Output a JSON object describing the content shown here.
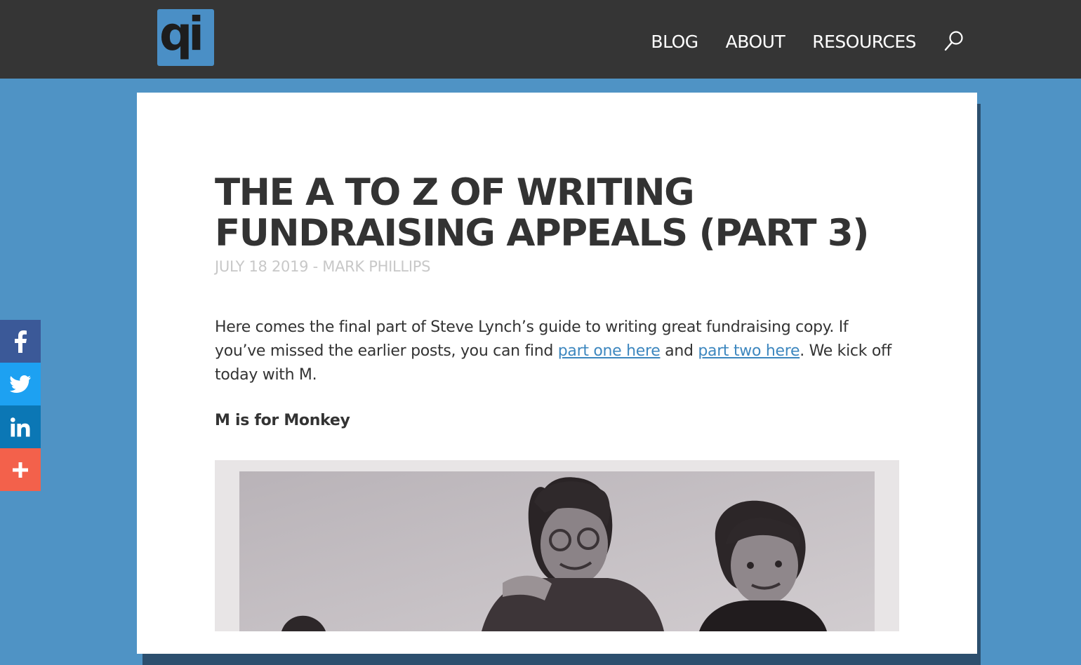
{
  "header": {
    "logo_text": "qi",
    "nav": {
      "blog": "BLOG",
      "about": "ABOUT",
      "resources": "RESOURCES"
    },
    "search_icon": "search-icon"
  },
  "article": {
    "title": "THE A TO Z OF WRITING FUNDRAISING APPEALS (PART 3)",
    "meta": "JULY 18 2019 - MARK PHILLIPS",
    "intro": {
      "text_1": "Here comes the final part of Steve Lynch’s guide to writing great fundraising copy. If you’ve missed the earlier posts, you can find ",
      "link_1": "part one here",
      "text_2": " and ",
      "link_2": "part two here",
      "text_3": ". We kick off today with M."
    },
    "subhead": "M is for Monkey",
    "image": "black-and-white photo of two smiling children"
  },
  "social": {
    "facebook": "facebook-icon",
    "twitter": "twitter-icon",
    "linkedin": "linkedin-icon",
    "more": "plus-icon"
  },
  "colors": {
    "page_background": "#4f93c5",
    "header_background": "#353535",
    "logo_background": "#4a8fc6",
    "link": "#3d87bf",
    "facebook": "#3b5998",
    "twitter": "#1da1f2",
    "linkedin": "#0b77b5",
    "more": "#f3614b"
  }
}
